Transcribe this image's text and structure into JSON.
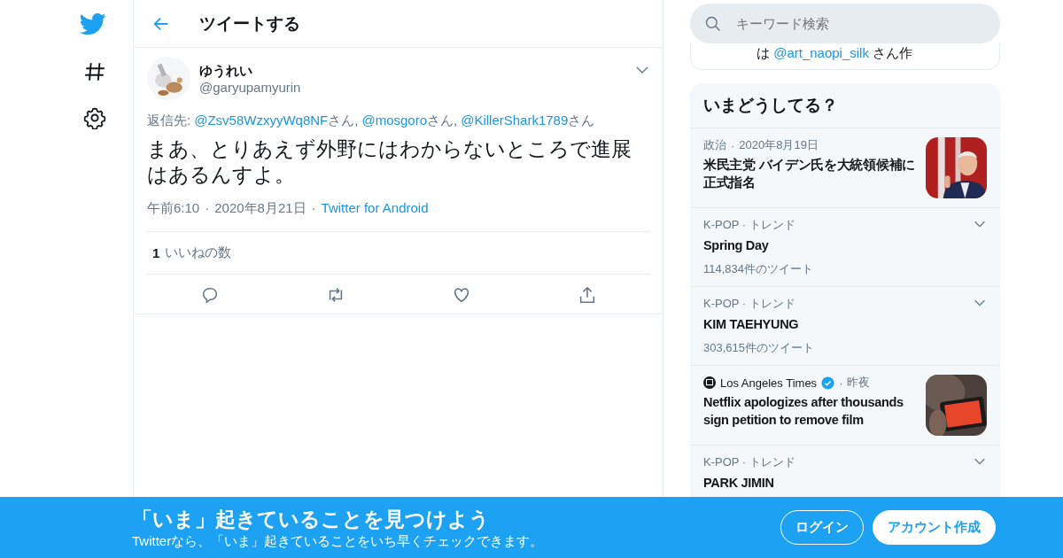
{
  "header": {
    "title": "ツイートする"
  },
  "tweet": {
    "name": "ゆうれい",
    "handle": "@garyupamyurin",
    "reply_label": "返信先:",
    "reply_to": [
      {
        "handle": "@Zsv58WzxyyWq8NF",
        "suffix": "さん,"
      },
      {
        "handle": "@mosgoro",
        "suffix": "さん,"
      },
      {
        "handle": "@KillerShark1789",
        "suffix": "さん"
      }
    ],
    "text": "まあ、とりあえず外野にはわからないところで進展はあるんすよ。",
    "time": "午前6:10",
    "separators": [
      "·",
      "·"
    ],
    "date": "2020年8月21日",
    "source": "Twitter for Android",
    "likes_count": "1",
    "likes_label": "いいねの数"
  },
  "search": {
    "placeholder": "キーワード検索"
  },
  "partial_card": {
    "prefix": "は",
    "link": "@art_naopi_silk",
    "suffix": "さん作"
  },
  "trends": {
    "title": "いまどうしてる？",
    "items": [
      {
        "kind": "news",
        "context": "政治",
        "separator": "·",
        "time": "2020年8月19日",
        "headline": "米民主党 バイデン氏を大統領候補に正式指名"
      },
      {
        "kind": "trend",
        "context": "K-POP · トレンド",
        "headline": "Spring Day",
        "count": "114,834件のツイート"
      },
      {
        "kind": "trend",
        "context": "K-POP · トレンド",
        "headline": "KIM TAEHYUNG",
        "count": "303,615件のツイート"
      },
      {
        "kind": "news",
        "source": "Los Angeles Times",
        "verified": true,
        "separator": "·",
        "time": "昨夜",
        "headline": "Netflix apologizes after thousands sign petition to remove film"
      },
      {
        "kind": "trend",
        "context": "K-POP · トレンド",
        "headline": "PARK JIMIN"
      }
    ]
  },
  "banner": {
    "title": "「いま」起きていることを見つけよう",
    "subtitle": "Twitterなら、「いま」起きていることをいち早くチェックできます。",
    "buttons": [
      {
        "label": "ログイン",
        "kind": "outline"
      },
      {
        "label": "アカウント作成",
        "kind": "filled"
      }
    ]
  }
}
